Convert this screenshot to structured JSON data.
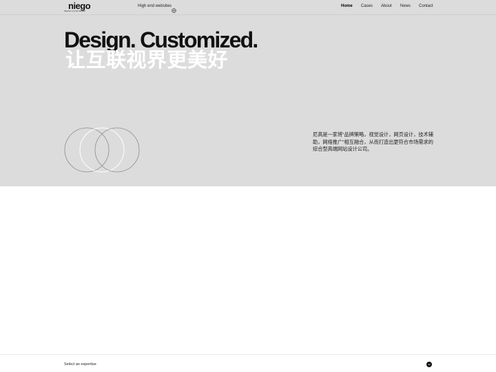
{
  "brand": {
    "logo_text": "niego",
    "logo_sub": "DESIGN & CUSTOMIZED"
  },
  "header": {
    "tagline": "High end websites",
    "language_icon": "globe-icon",
    "nav": [
      {
        "label": "Home",
        "active": true
      },
      {
        "label": "Cases",
        "active": false
      },
      {
        "label": "About",
        "active": false
      },
      {
        "label": "News",
        "active": false
      },
      {
        "label": "Contact",
        "active": false
      }
    ]
  },
  "hero": {
    "headline": "Design. Customized.",
    "subheadline": "让互联视界更美好",
    "description": "尼高是一家将“品牌策略，视觉设计，网页设计，技术辅助，网络推广”相互融合，从而打造出更符合市场需求的综合型高端网站设计公司。",
    "background_color": "#dcdcdc"
  },
  "footer": {
    "expertise_label": "Select an expertise",
    "toggle_icon": "chevron-down-icon"
  }
}
